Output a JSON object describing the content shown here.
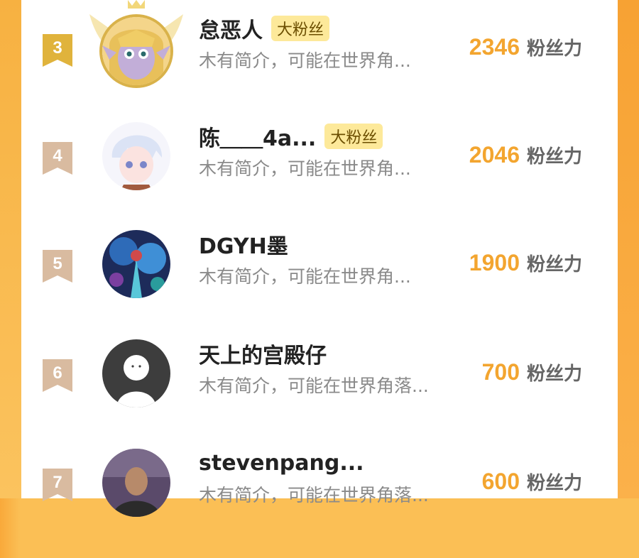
{
  "colors": {
    "accent": "#f3a52f",
    "border": "#fbb94a",
    "tag_bg": "#fde99a"
  },
  "fans": [
    {
      "rank": "3",
      "name": "怠恶人",
      "tag": "大粉丝",
      "desc": "木有简介，可能在世界角...",
      "score": "2346",
      "unit": "粉丝力",
      "badge_color": "#e0b33c",
      "avatar_icon": "anime-elf-girl-avatar"
    },
    {
      "rank": "4",
      "name": "陈＿＿4a...",
      "tag": "大粉丝",
      "desc": "木有简介，可能在世界角...",
      "score": "2046",
      "unit": "粉丝力",
      "badge_color": "#d9bba0",
      "avatar_icon": "anime-white-hair-avatar"
    },
    {
      "rank": "5",
      "name": "DGYH墨",
      "tag": "",
      "desc": "木有简介，可能在世界角...",
      "score": "1900",
      "unit": "粉丝力",
      "badge_color": "#d9bba0",
      "avatar_icon": "blue-artwork-avatar"
    },
    {
      "rank": "6",
      "name": "天上的宫殿仔",
      "tag": "",
      "desc": "木有简介，可能在世界角落...",
      "score": "700",
      "unit": "粉丝力",
      "badge_color": "#d9bba0",
      "avatar_icon": "default-user-avatar"
    },
    {
      "rank": "7",
      "name": "stevenpang...",
      "tag": "",
      "desc": "木有简介，可能在世界角落...",
      "score": "600",
      "unit": "粉丝力",
      "badge_color": "#d9bba0",
      "avatar_icon": "photo-man-avatar"
    }
  ]
}
